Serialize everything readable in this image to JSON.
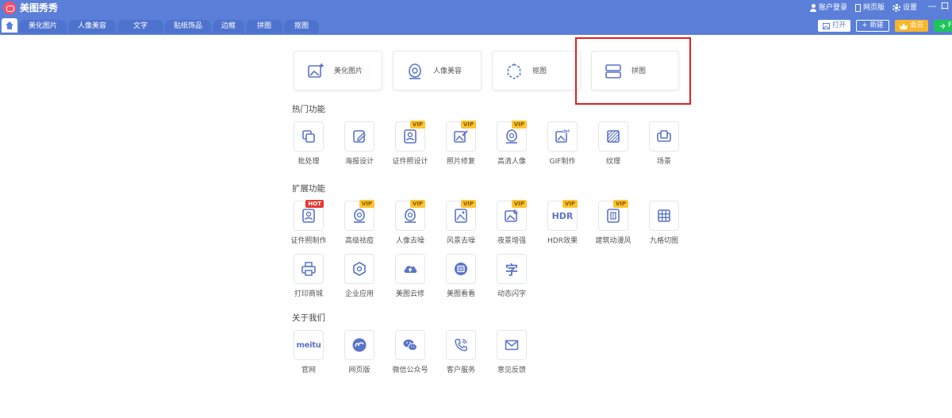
{
  "app": {
    "title": "美图秀秀"
  },
  "titlebar": {
    "login": "账户登录",
    "web": "网页版",
    "settings": "设置",
    "minimize": "—",
    "close": "口"
  },
  "tabs": [
    "美化图片",
    "人像美容",
    "文字",
    "贴纸饰品",
    "边框",
    "拼图",
    "抠图"
  ],
  "toolbar": {
    "open": "打开",
    "new": "新建",
    "vip": "会员",
    "green": "F"
  },
  "main_cards": [
    {
      "label": "美化图片",
      "icon": "image-edit-icon"
    },
    {
      "label": "人像美容",
      "icon": "face-icon"
    },
    {
      "label": "抠图",
      "icon": "cutout-icon"
    },
    {
      "label": "拼图",
      "icon": "collage-icon"
    }
  ],
  "sections": {
    "hot": {
      "title": "热门功能",
      "items": [
        {
          "label": "批处理",
          "icon": "batch-icon",
          "badge": ""
        },
        {
          "label": "海报设计",
          "icon": "poster-icon",
          "badge": ""
        },
        {
          "label": "证件照设计",
          "icon": "id-photo-icon",
          "badge": "VIP"
        },
        {
          "label": "照片修复",
          "icon": "photo-repair-icon",
          "badge": "VIP"
        },
        {
          "label": "高清人像",
          "icon": "hd-portrait-icon",
          "badge": "VIP"
        },
        {
          "label": "GIF制作",
          "icon": "gif-icon",
          "badge": ""
        },
        {
          "label": "纹理",
          "icon": "texture-icon",
          "badge": ""
        },
        {
          "label": "场景",
          "icon": "scene-icon",
          "badge": ""
        }
      ]
    },
    "ext": {
      "title": "扩展功能",
      "items": [
        {
          "label": "证件照制作",
          "icon": "id-photo-make-icon",
          "badge": "HOT"
        },
        {
          "label": "高级祛痘",
          "icon": "acne-icon",
          "badge": "VIP"
        },
        {
          "label": "人像去噪",
          "icon": "portrait-denoise-icon",
          "badge": "VIP"
        },
        {
          "label": "风景去噪",
          "icon": "landscape-denoise-icon",
          "badge": "VIP"
        },
        {
          "label": "夜景增强",
          "icon": "night-enhance-icon",
          "badge": "VIP"
        },
        {
          "label": "HDR效果",
          "icon": "hdr-icon",
          "badge": "VIP"
        },
        {
          "label": "建筑动漫风",
          "icon": "anime-icon",
          "badge": "VIP"
        },
        {
          "label": "九格切图",
          "icon": "grid-cut-icon",
          "badge": ""
        },
        {
          "label": "打印商城",
          "icon": "print-icon",
          "badge": ""
        },
        {
          "label": "企业应用",
          "icon": "enterprise-icon",
          "badge": ""
        },
        {
          "label": "美图云修",
          "icon": "cloud-icon",
          "badge": ""
        },
        {
          "label": "美图看看",
          "icon": "viewer-icon",
          "badge": ""
        },
        {
          "label": "动态闪字",
          "icon": "flash-text-icon",
          "badge": ""
        }
      ],
      "hdr_glyph": "HDR",
      "text_glyph": "字"
    },
    "about": {
      "title": "关于我们",
      "items": [
        {
          "label": "官网",
          "icon": "meitu-logo-icon",
          "badge": ""
        },
        {
          "label": "网页版",
          "icon": "web-icon",
          "badge": ""
        },
        {
          "label": "微信公众号",
          "icon": "wechat-icon",
          "badge": ""
        },
        {
          "label": "客户服务",
          "icon": "phone-icon",
          "badge": ""
        },
        {
          "label": "意见反馈",
          "icon": "mail-icon",
          "badge": ""
        }
      ],
      "logo_text": "meitu"
    }
  },
  "colors": {
    "brand": "#5b7fd8",
    "icon": "#5a74c9",
    "vip": "#ffc42e",
    "hot": "#e53935",
    "highlight": "#e02020"
  }
}
